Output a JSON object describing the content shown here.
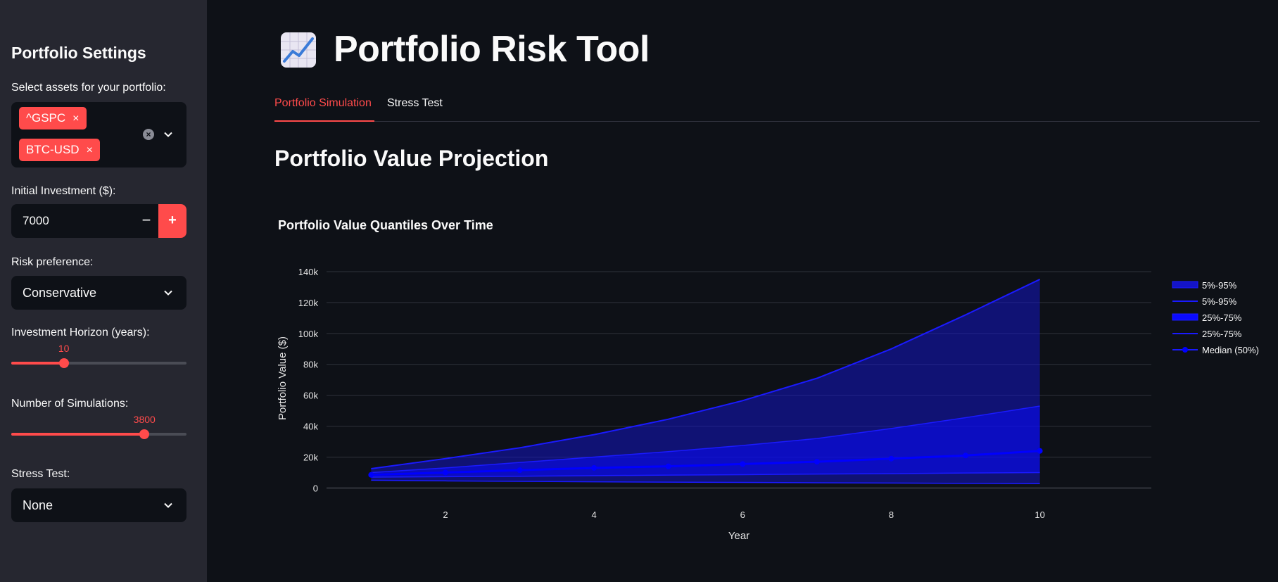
{
  "sidebar": {
    "title": "Portfolio Settings",
    "assets": {
      "label": "Select assets for your portfolio:",
      "selected": [
        {
          "name": "^GSPC",
          "remove": "×"
        },
        {
          "name": "BTC-USD",
          "remove": "×"
        }
      ]
    },
    "investment": {
      "label": "Initial Investment ($):",
      "value": "7000",
      "minus": "−",
      "plus": "+"
    },
    "risk": {
      "label": "Risk preference:",
      "value": "Conservative"
    },
    "horizon": {
      "label": "Investment Horizon (years):",
      "value": "10",
      "fraction": 0.3
    },
    "simulations": {
      "label": "Number of Simulations:",
      "value": "3800",
      "fraction": 0.76
    },
    "stress": {
      "label": "Stress Test:",
      "value": "None"
    }
  },
  "header": {
    "title": "Portfolio Risk Tool",
    "icon": "chart-increasing-icon"
  },
  "tabs": [
    {
      "label": "Portfolio Simulation",
      "active": true
    },
    {
      "label": "Stress Test",
      "active": false
    }
  ],
  "main": {
    "section_title": "Portfolio Value Projection"
  },
  "colors": {
    "accent": "#ff4b4b",
    "series": "#0000ff",
    "background": "#0e1117",
    "sidebar": "#262730"
  },
  "chart_data": {
    "type": "area",
    "title": "Portfolio Value Quantiles Over Time",
    "xlabel": "Year",
    "ylabel": "Portfolio Value ($)",
    "xlim": [
      0.4,
      11.5
    ],
    "ylim": [
      -3000,
      145000
    ],
    "x_ticks": [
      2,
      4,
      6,
      8,
      10
    ],
    "y_ticks": [
      0,
      20000,
      40000,
      60000,
      80000,
      100000,
      120000,
      140000
    ],
    "y_tick_labels": [
      "0",
      "20k",
      "40k",
      "60k",
      "80k",
      "100k",
      "120k",
      "140k"
    ],
    "grid": true,
    "legend_position": "right",
    "legend": [
      "5%-95%",
      "5%-95%",
      "25%-75%",
      "25%-75%",
      "Median (50%)"
    ],
    "x": [
      1,
      2,
      3,
      4,
      5,
      6,
      7,
      8,
      9,
      10
    ],
    "series": [
      {
        "name": "5%-95%",
        "lower": [
          5000,
          4600,
          4300,
          4000,
          3800,
          3600,
          3400,
          3200,
          3000,
          2800
        ],
        "upper": [
          12500,
          19000,
          26000,
          34500,
          44500,
          56500,
          71000,
          90000,
          112000,
          135000
        ]
      },
      {
        "name": "25%-75%",
        "lower": [
          7000,
          7300,
          7600,
          8000,
          8300,
          8600,
          9000,
          9300,
          9700,
          10000
        ],
        "upper": [
          10000,
          13000,
          16500,
          20000,
          23500,
          27500,
          32000,
          38500,
          45500,
          53000
        ]
      },
      {
        "name": "Median (50%)",
        "values": [
          8500,
          10000,
          11500,
          13000,
          14000,
          15500,
          17000,
          19000,
          21000,
          24000
        ]
      }
    ]
  }
}
